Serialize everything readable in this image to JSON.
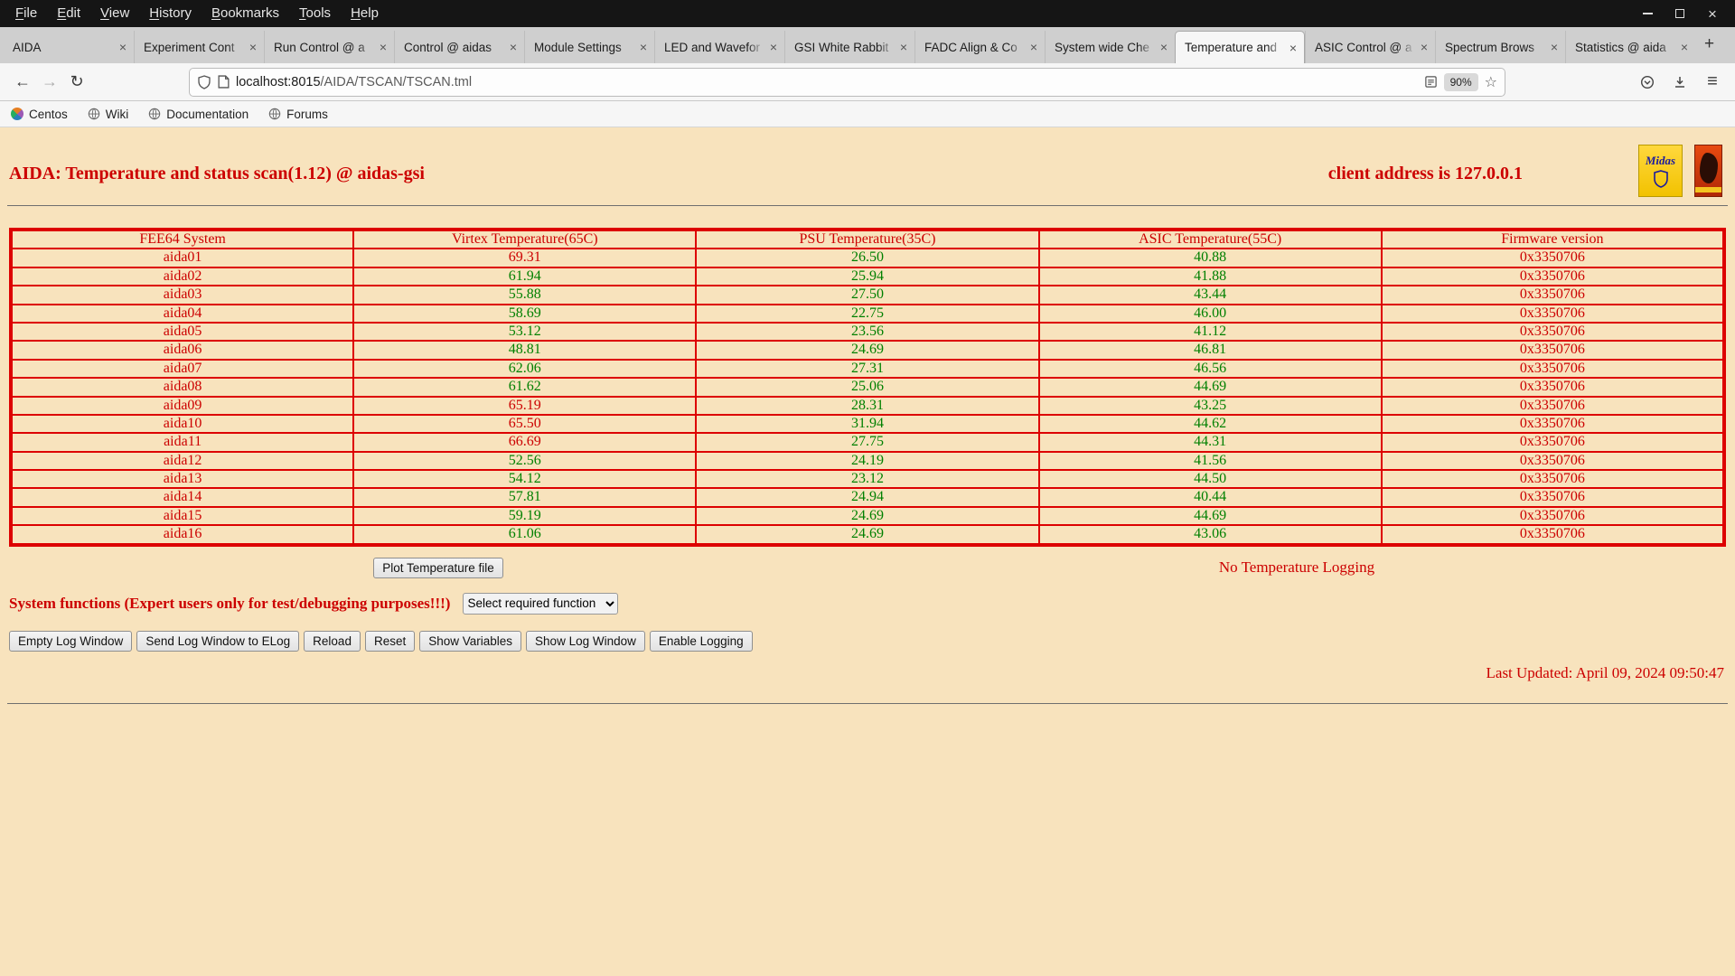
{
  "window": {
    "menu_items": [
      "File",
      "Edit",
      "View",
      "History",
      "Bookmarks",
      "Tools",
      "Help"
    ]
  },
  "tabs": [
    {
      "label": "AIDA",
      "active": false
    },
    {
      "label": "Experiment Cont",
      "active": false
    },
    {
      "label": "Run Control @ a",
      "active": false
    },
    {
      "label": "Control @ aidas",
      "active": false
    },
    {
      "label": "Module Settings",
      "active": false
    },
    {
      "label": "LED and Wavefor",
      "active": false
    },
    {
      "label": "GSI White Rabbit",
      "active": false
    },
    {
      "label": "FADC Align & Co",
      "active": false
    },
    {
      "label": "System wide Che",
      "active": false
    },
    {
      "label": "Temperature and",
      "active": true
    },
    {
      "label": "ASIC Control @ a",
      "active": false
    },
    {
      "label": "Spectrum Brows",
      "active": false
    },
    {
      "label": "Statistics @ aida",
      "active": false
    }
  ],
  "toolbar": {
    "url_host": "localhost:8015",
    "url_path": "/AIDA/TSCAN/TSCAN.tml",
    "zoom_level": "90%"
  },
  "bookmarks": [
    "Centos",
    "Wiki",
    "Documentation",
    "Forums"
  ],
  "page": {
    "title": "AIDA: Temperature and status scan(1.12) @ aidas-gsi",
    "client_address": "client address is 127.0.0.1",
    "midas_logo_text": "Midas",
    "table": {
      "headers": [
        "FEE64 System",
        "Virtex Temperature(65C)",
        "PSU Temperature(35C)",
        "ASIC Temperature(55C)",
        "Firmware version"
      ],
      "thresholds": {
        "virtex": 65,
        "psu": 35,
        "asic": 55
      },
      "rows": [
        {
          "system": "aida01",
          "virtex": "69.31",
          "psu": "26.50",
          "asic": "40.88",
          "firmware": "0x3350706"
        },
        {
          "system": "aida02",
          "virtex": "61.94",
          "psu": "25.94",
          "asic": "41.88",
          "firmware": "0x3350706"
        },
        {
          "system": "aida03",
          "virtex": "55.88",
          "psu": "27.50",
          "asic": "43.44",
          "firmware": "0x3350706"
        },
        {
          "system": "aida04",
          "virtex": "58.69",
          "psu": "22.75",
          "asic": "46.00",
          "firmware": "0x3350706"
        },
        {
          "system": "aida05",
          "virtex": "53.12",
          "psu": "23.56",
          "asic": "41.12",
          "firmware": "0x3350706"
        },
        {
          "system": "aida06",
          "virtex": "48.81",
          "psu": "24.69",
          "asic": "46.81",
          "firmware": "0x3350706"
        },
        {
          "system": "aida07",
          "virtex": "62.06",
          "psu": "27.31",
          "asic": "46.56",
          "firmware": "0x3350706"
        },
        {
          "system": "aida08",
          "virtex": "61.62",
          "psu": "25.06",
          "asic": "44.69",
          "firmware": "0x3350706"
        },
        {
          "system": "aida09",
          "virtex": "65.19",
          "psu": "28.31",
          "asic": "43.25",
          "firmware": "0x3350706"
        },
        {
          "system": "aida10",
          "virtex": "65.50",
          "psu": "31.94",
          "asic": "44.62",
          "firmware": "0x3350706"
        },
        {
          "system": "aida11",
          "virtex": "66.69",
          "psu": "27.75",
          "asic": "44.31",
          "firmware": "0x3350706"
        },
        {
          "system": "aida12",
          "virtex": "52.56",
          "psu": "24.19",
          "asic": "41.56",
          "firmware": "0x3350706"
        },
        {
          "system": "aida13",
          "virtex": "54.12",
          "psu": "23.12",
          "asic": "44.50",
          "firmware": "0x3350706"
        },
        {
          "system": "aida14",
          "virtex": "57.81",
          "psu": "24.94",
          "asic": "40.44",
          "firmware": "0x3350706"
        },
        {
          "system": "aida15",
          "virtex": "59.19",
          "psu": "24.69",
          "asic": "44.69",
          "firmware": "0x3350706"
        },
        {
          "system": "aida16",
          "virtex": "61.06",
          "psu": "24.69",
          "asic": "43.06",
          "firmware": "0x3350706"
        }
      ]
    },
    "plot_button_label": "Plot Temperature file",
    "logging_status": "No Temperature Logging",
    "system_functions_label": "System functions (Expert users only for test/debugging purposes!!!)",
    "function_select_value": "Select required function",
    "function_buttons": [
      "Empty Log Window",
      "Send Log Window to ELog",
      "Reload",
      "Reset",
      "Show Variables",
      "Show Log Window",
      "Enable Logging"
    ],
    "last_updated": "Last Updated: April 09, 2024 09:50:47",
    "colors": {
      "alert": "#cc0000",
      "ok": "#008000",
      "table_border": "#dd0000",
      "page_bg": "#f8e3bd"
    }
  }
}
